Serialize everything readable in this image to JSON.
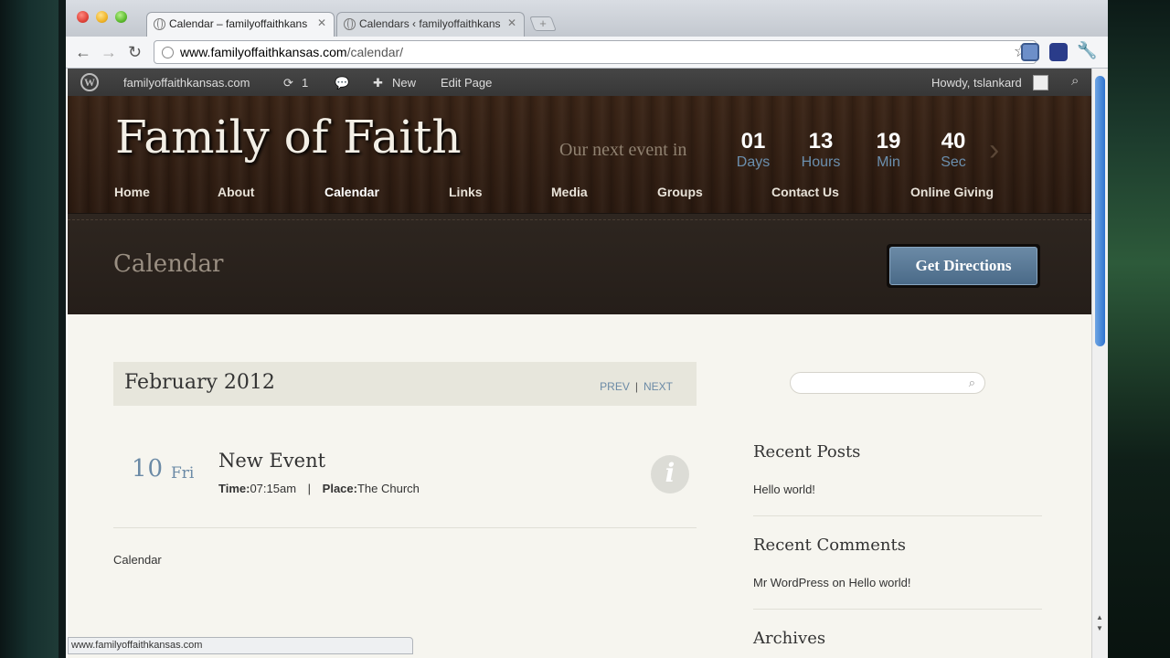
{
  "browser": {
    "tabs": [
      {
        "label": "Calendar – familyoffaithkans",
        "active": true
      },
      {
        "label": "Calendars ‹ familyoffaithkans",
        "active": false
      }
    ],
    "url_host": "www.familyoffaithkansas.com",
    "url_path": "/calendar/",
    "status_url": "www.familyoffaithkansas.com"
  },
  "adminbar": {
    "site": "familyoffaithkansas.com",
    "updates": "1",
    "new": "New",
    "edit": "Edit Page",
    "howdy": "Howdy, tslankard"
  },
  "header": {
    "site_title": "Family of Faith",
    "next_event_label": "Our next event in",
    "countdown": [
      {
        "value": "01",
        "unit": "Days"
      },
      {
        "value": "13",
        "unit": "Hours"
      },
      {
        "value": "19",
        "unit": "Min"
      },
      {
        "value": "40",
        "unit": "Sec"
      }
    ],
    "nav": [
      "Home",
      "About",
      "Calendar",
      "Links",
      "Media",
      "Groups",
      "Contact Us",
      "Online Giving"
    ],
    "current_nav": "Calendar"
  },
  "titleband": {
    "page_title": "Calendar",
    "directions_button": "Get Directions"
  },
  "calendar": {
    "month": "February 2012",
    "prev": "PREV",
    "separator": "|",
    "next": "NEXT",
    "event": {
      "day": "10",
      "weekday": "Fri",
      "title": "New Event",
      "time_label": "Time:",
      "time": "07:15am",
      "meta_sep": "|",
      "place_label": "Place:",
      "place": "The Church"
    },
    "footer_link": "Calendar"
  },
  "sidebar": {
    "search_placeholder": "",
    "recent_posts_title": "Recent Posts",
    "recent_posts": [
      "Hello world!"
    ],
    "recent_comments_title": "Recent Comments",
    "recent_comment_author": "Mr WordPress",
    "recent_comment_on": "on",
    "recent_comment_post": "Hello world!",
    "archives_title": "Archives"
  }
}
